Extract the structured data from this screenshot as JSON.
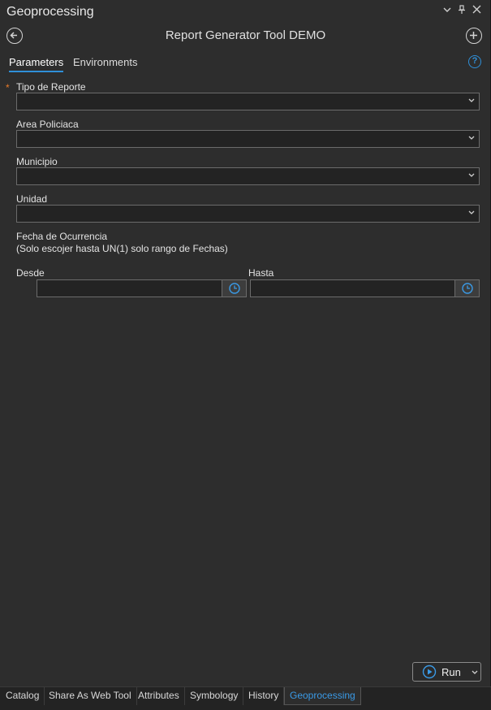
{
  "window": {
    "title": "Geoprocessing",
    "controls": [
      "chevron-down-icon",
      "pin-icon",
      "close-icon"
    ]
  },
  "toolbar": {
    "back_icon": "back-arrow-icon",
    "tool_title": "Report Generator Tool DEMO",
    "add_icon": "plus-icon"
  },
  "tabs": {
    "parameters": "Parameters",
    "environments": "Environments",
    "help_label": "?"
  },
  "params": {
    "required_marker": "*",
    "tipo_reporte": {
      "label": "Tipo de Reporte",
      "value": ""
    },
    "area_policiaca": {
      "label": "Area Policiaca",
      "value": ""
    },
    "municipio": {
      "label": "Municipio",
      "value": ""
    },
    "unidad": {
      "label": "Unidad",
      "value": ""
    },
    "fecha_title": "Fecha de Ocurrencia",
    "fecha_note": "(Solo escojer hasta UN(1) solo rango de Fechas)",
    "desde": {
      "label": "Desde",
      "value": ""
    },
    "hasta": {
      "label": "Hasta",
      "value": ""
    }
  },
  "run_button": {
    "label": "Run"
  },
  "bottom_tabs": {
    "catalog": "Catalog",
    "share": "Share As Web Tool",
    "attributes": "Attributes",
    "symbology": "Symbology",
    "history": "History",
    "geoprocessing": "Geoprocessing"
  },
  "colors": {
    "background": "#2d2d2d",
    "accent": "#2f8fd8",
    "required": "#e87a2a"
  }
}
